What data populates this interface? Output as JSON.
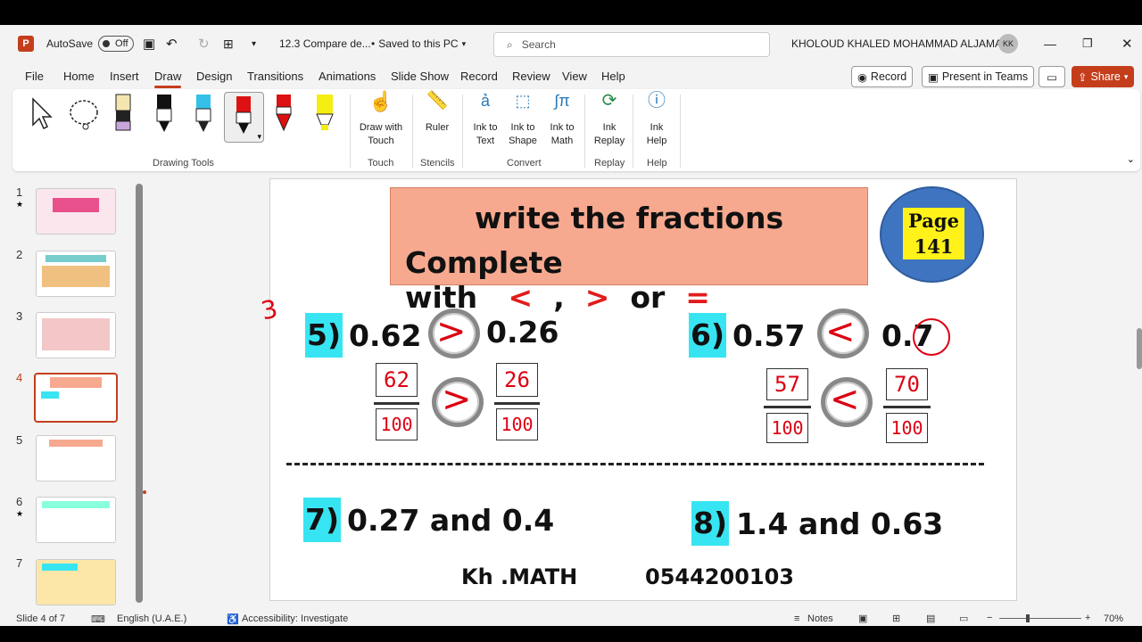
{
  "titlebar": {
    "autosave_label": "AutoSave",
    "autosave_state": "Off",
    "filename": "12.3  Compare de...",
    "saved_status": "Saved to this PC",
    "search_placeholder": "Search",
    "user_name": "KHOLOUD KHALED MOHAMMAD  ALJAMAL",
    "user_initials": "KK"
  },
  "menu": {
    "tabs": [
      "File",
      "Home",
      "Insert",
      "Draw",
      "Design",
      "Transitions",
      "Animations",
      "Slide Show",
      "Record",
      "Review",
      "View",
      "Help"
    ],
    "active": "Draw",
    "record_btn": "Record",
    "present_btn": "Present in Teams",
    "share_btn": "Share"
  },
  "ribbon": {
    "groups": {
      "drawing_tools": "Drawing Tools",
      "touch": "Touch",
      "stencils": "Stencils",
      "convert": "Convert",
      "replay": "Replay",
      "help": "Help"
    },
    "draw_with_touch": "Draw with Touch",
    "ruler": "Ruler",
    "ink_to_text": "Ink to Text",
    "ink_to_shape": "Ink to Shape",
    "ink_to_math": "Ink to Math",
    "ink_replay": "Ink Replay",
    "ink_help": "Ink Help"
  },
  "thumbnails": [
    {
      "num": "1"
    },
    {
      "num": "2"
    },
    {
      "num": "3"
    },
    {
      "num": "4"
    },
    {
      "num": "5"
    },
    {
      "num": "6"
    },
    {
      "num": "7"
    }
  ],
  "slide": {
    "title_line1": "write the fractions",
    "title_line2_prefix": "Complete with",
    "sym_lt": "<",
    "sym_comma": ",",
    "sym_gt": ">",
    "sym_or": "or",
    "sym_eq": "=",
    "page_label": "Page",
    "page_number": "141",
    "q5_num": "5)",
    "q5_a": "0.62",
    "q5_b": "0.26",
    "q6_num": "6)",
    "q6_a": "0.57",
    "q6_b": "0.7",
    "q7_num": "7)",
    "q7_text": "0.27 and 0.4",
    "q8_num": "8)",
    "q8_text": "1.4 and 0.63",
    "footer_name": "Kh .MATH",
    "footer_phone": "0544200103",
    "ink": {
      "q5_num": "62",
      "q5_den": "100",
      "q5_num_b": "26",
      "q5_den_b": "100",
      "q6_num": "57",
      "q6_den": "100",
      "q6_num_b": "70",
      "q6_den_b": "100",
      "side_mark": "3"
    }
  },
  "status": {
    "slide_info": "Slide 4 of 7",
    "language": "English (U.A.E.)",
    "accessibility": "Accessibility: Investigate",
    "notes": "Notes",
    "zoom": "70%"
  }
}
